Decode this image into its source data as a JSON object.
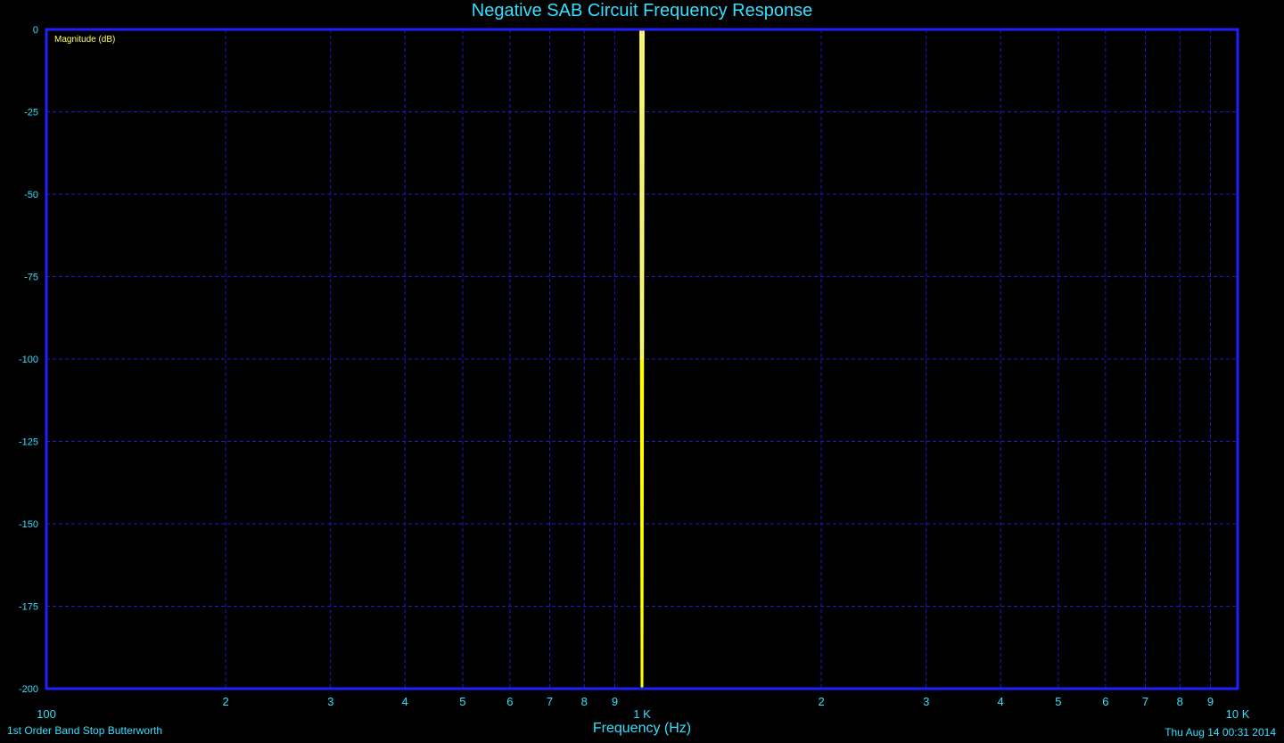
{
  "chart_data": {
    "type": "line",
    "title": "Negative SAB Circuit Frequency Response",
    "xlabel": "Frequency (Hz)",
    "ylabel": "Magnitude (dB)",
    "subtitle": "1st Order Band Stop Butterworth",
    "timestamp": "Thu Aug 14 00:31 2014",
    "x_scale": "log",
    "xlim": [
      100,
      10000
    ],
    "ylim": [
      -200,
      0
    ],
    "grid": true,
    "colors": {
      "background": "#000000",
      "frame": "#1f1fff",
      "grid": "#1a1ad0",
      "text": "#33e0ff",
      "trace": "#ffff00",
      "trace_highlight": "#ffffff"
    },
    "y_ticks": [
      {
        "value": 0,
        "label": "0"
      },
      {
        "value": -25,
        "label": "-25"
      },
      {
        "value": -50,
        "label": "-50"
      },
      {
        "value": -75,
        "label": "-75"
      },
      {
        "value": -100,
        "label": "-100"
      },
      {
        "value": -125,
        "label": "-125"
      },
      {
        "value": -150,
        "label": "-150"
      },
      {
        "value": -175,
        "label": "-175"
      },
      {
        "value": -200,
        "label": "-200"
      }
    ],
    "x_ticks": [
      {
        "value": 100,
        "label": "100"
      },
      {
        "value": 200,
        "label": "2"
      },
      {
        "value": 300,
        "label": "3"
      },
      {
        "value": 400,
        "label": "4"
      },
      {
        "value": 500,
        "label": "5"
      },
      {
        "value": 600,
        "label": "6"
      },
      {
        "value": 700,
        "label": "7"
      },
      {
        "value": 800,
        "label": "8"
      },
      {
        "value": 900,
        "label": "9"
      },
      {
        "value": 1000,
        "label": "1 K"
      },
      {
        "value": 2000,
        "label": "2"
      },
      {
        "value": 3000,
        "label": "3"
      },
      {
        "value": 4000,
        "label": "4"
      },
      {
        "value": 5000,
        "label": "5"
      },
      {
        "value": 6000,
        "label": "6"
      },
      {
        "value": 7000,
        "label": "7"
      },
      {
        "value": 8000,
        "label": "8"
      },
      {
        "value": 9000,
        "label": "9"
      },
      {
        "value": 10000,
        "label": "10 K"
      }
    ],
    "series": [
      {
        "x": [
          100,
          995,
          1000,
          1000,
          1005,
          10000
        ],
        "y": [
          0,
          0,
          -200,
          -200,
          0,
          0
        ]
      }
    ]
  }
}
